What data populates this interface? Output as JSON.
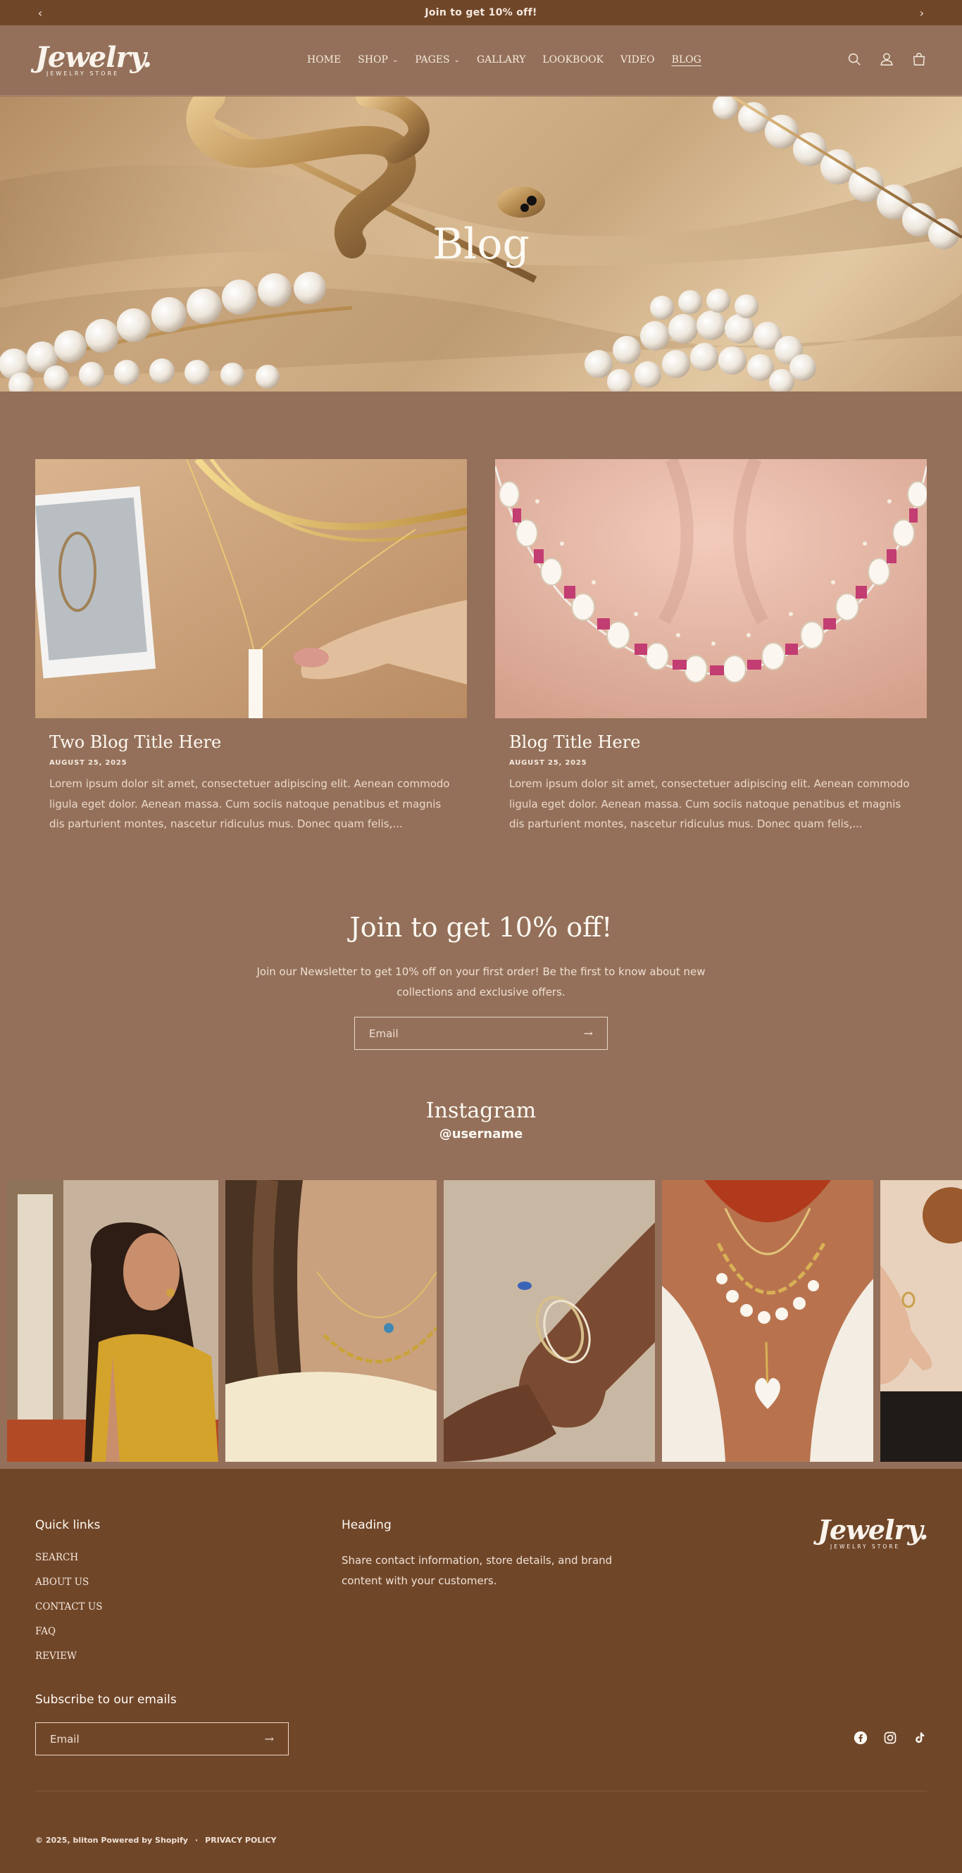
{
  "announcement": {
    "text": "Join to get 10% off!",
    "prev": "‹",
    "next": "›"
  },
  "header": {
    "logo_word": "Jewelry.",
    "logo_sub": "JEWELRY STORE",
    "nav": [
      {
        "label": "HOME"
      },
      {
        "label": "SHOP",
        "chev": "⌄"
      },
      {
        "label": "PAGES",
        "chev": "⌄"
      },
      {
        "label": "GALLARY"
      },
      {
        "label": "LOOKBOOK"
      },
      {
        "label": "VIDEO"
      },
      {
        "label": "BLOG"
      }
    ],
    "icons": [
      "search-icon",
      "account-icon",
      "cart-icon"
    ]
  },
  "hero": {
    "title": "Blog"
  },
  "posts": [
    {
      "title": "Two Blog Title Here",
      "date": "AUGUST 25, 2025",
      "excerpt": "Lorem ipsum dolor sit amet, consectetuer adipiscing elit. Aenean commodo ligula eget dolor. Aenean massa. Cum sociis natoque penatibus et magnis dis parturient montes, nascetur ridiculus mus. Donec quam felis,..."
    },
    {
      "title": "Blog Title Here",
      "date": "AUGUST 25, 2025",
      "excerpt": "Lorem ipsum dolor sit amet, consectetuer adipiscing elit. Aenean commodo ligula eget dolor. Aenean massa. Cum sociis natoque penatibus et magnis dis parturient montes, nascetur ridiculus mus. Donec quam felis,..."
    }
  ],
  "newsletter": {
    "title": "Join to get 10% off!",
    "description": "Join our Newsletter to get 10% off on your first order! Be the first to know about new collections and exclusive offers.",
    "placeholder": "Email",
    "submit": "→"
  },
  "instagram": {
    "title": "Instagram",
    "username": "@username"
  },
  "footer": {
    "quick_links_heading": "Quick links",
    "quick_links": [
      "SEARCH",
      "ABOUT US",
      "CONTACT US",
      "FAQ",
      "REVIEW"
    ],
    "heading": "Heading",
    "text": "Share contact information, store details, and brand content with your customers.",
    "logo_word": "Jewelry.",
    "logo_sub": "JEWELRY STORE",
    "subscribe_heading": "Subscribe to our emails",
    "subscribe_placeholder": "Email",
    "subscribe_submit": "→",
    "socials": [
      "facebook-icon",
      "instagram-icon",
      "tiktok-icon"
    ],
    "copyright": "© 2025, bliton Powered by Shopify",
    "separator": "·",
    "privacy": "PRIVACY POLICY"
  },
  "colors": {
    "page_bg": "#94705a",
    "bar_bg": "#704629",
    "text": "#fffaf3"
  }
}
